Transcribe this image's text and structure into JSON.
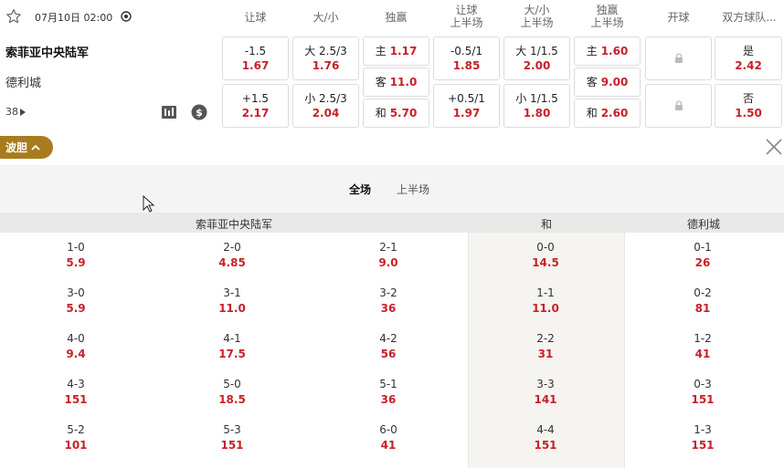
{
  "match": {
    "datetime": "07月10日 02:00",
    "home": "索菲亚中央陆军",
    "away": "德利城",
    "more_count": "38"
  },
  "columns": {
    "handicap": "让球",
    "total": "大/小",
    "moneyline": "独赢",
    "handicap_half_l1": "让球",
    "handicap_half_l2": "上半场",
    "total_half_l1": "大/小",
    "total_half_l2": "上半场",
    "ml_half_l1": "独赢",
    "ml_half_l2": "上半场",
    "first_goal": "开球",
    "both_score": "双方球队..."
  },
  "odds": {
    "handicap": [
      {
        "label": "-1.5",
        "odd": "1.67"
      },
      {
        "label": "+1.5",
        "odd": "2.17"
      }
    ],
    "total": [
      {
        "label": "大 2.5/3",
        "odd": "1.76"
      },
      {
        "label": "小 2.5/3",
        "odd": "2.04"
      }
    ],
    "moneyline": [
      {
        "label": "主",
        "odd": "1.17"
      },
      {
        "label": "客",
        "odd": "11.0"
      },
      {
        "label": "和",
        "odd": "5.70"
      }
    ],
    "handicap_half": [
      {
        "label": "-0.5/1",
        "odd": "1.85"
      },
      {
        "label": "+0.5/1",
        "odd": "1.97"
      }
    ],
    "total_half": [
      {
        "label": "大 1/1.5",
        "odd": "2.00"
      },
      {
        "label": "小 1/1.5",
        "odd": "1.80"
      }
    ],
    "ml_half": [
      {
        "label": "主",
        "odd": "1.60"
      },
      {
        "label": "客",
        "odd": "9.00"
      },
      {
        "label": "和",
        "odd": "2.60"
      }
    ],
    "both_score": [
      {
        "label": "是",
        "odd": "2.42"
      },
      {
        "label": "否",
        "odd": "1.50"
      }
    ]
  },
  "correct_score": {
    "button": "波胆",
    "tabs": [
      "全场",
      "上半场"
    ],
    "headers": {
      "home": "索菲亚中央陆军",
      "draw": "和",
      "away": "德利城"
    },
    "home_cols": [
      [
        {
          "s": "1-0",
          "o": "5.9"
        },
        {
          "s": "3-0",
          "o": "5.9"
        },
        {
          "s": "4-0",
          "o": "9.4"
        },
        {
          "s": "4-3",
          "o": "151"
        },
        {
          "s": "5-2",
          "o": "101"
        }
      ],
      [
        {
          "s": "2-0",
          "o": "4.85"
        },
        {
          "s": "3-1",
          "o": "11.0"
        },
        {
          "s": "4-1",
          "o": "17.5"
        },
        {
          "s": "5-0",
          "o": "18.5"
        },
        {
          "s": "5-3",
          "o": "151"
        }
      ],
      [
        {
          "s": "2-1",
          "o": "9.0"
        },
        {
          "s": "3-2",
          "o": "36"
        },
        {
          "s": "4-2",
          "o": "56"
        },
        {
          "s": "5-1",
          "o": "36"
        },
        {
          "s": "6-0",
          "o": "41"
        }
      ]
    ],
    "draw_col": [
      {
        "s": "0-0",
        "o": "14.5"
      },
      {
        "s": "1-1",
        "o": "11.0"
      },
      {
        "s": "2-2",
        "o": "31"
      },
      {
        "s": "3-3",
        "o": "141"
      },
      {
        "s": "4-4",
        "o": "151"
      }
    ],
    "away_col": [
      {
        "s": "0-1",
        "o": "26"
      },
      {
        "s": "0-2",
        "o": "81"
      },
      {
        "s": "1-2",
        "o": "41"
      },
      {
        "s": "0-3",
        "o": "151"
      },
      {
        "s": "1-3",
        "o": "151"
      }
    ]
  },
  "icons": {
    "star": "star-outline-icon",
    "live": "live-icon",
    "stats": "stats-icon",
    "money": "money-icon",
    "lock": "lock-icon",
    "close": "close-icon",
    "collapse": "chevron-up-icon"
  },
  "colors": {
    "odd": "#c8202a",
    "accent": "#a87c1e"
  }
}
